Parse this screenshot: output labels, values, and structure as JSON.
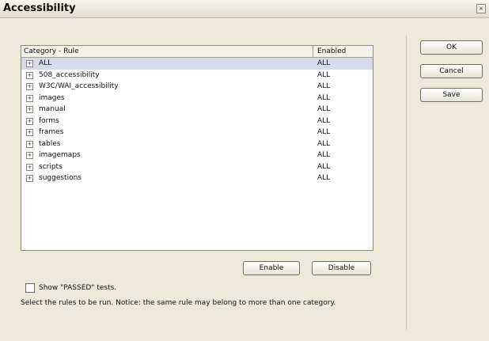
{
  "window": {
    "title": "Accessibility",
    "close_glyph": "×"
  },
  "list": {
    "columns": {
      "category": "Category - Rule",
      "enabled": "Enabled"
    },
    "rows": [
      {
        "label": "ALL",
        "enabled": "ALL",
        "selected": true
      },
      {
        "label": "508_accessibility",
        "enabled": "ALL"
      },
      {
        "label": "W3C/WAI_accessibility",
        "enabled": "ALL"
      },
      {
        "label": "images",
        "enabled": "ALL"
      },
      {
        "label": "manual",
        "enabled": "ALL"
      },
      {
        "label": "forms",
        "enabled": "ALL"
      },
      {
        "label": "frames",
        "enabled": "ALL"
      },
      {
        "label": "tables",
        "enabled": "ALL"
      },
      {
        "label": "imagemaps",
        "enabled": "ALL"
      },
      {
        "label": "scripts",
        "enabled": "ALL"
      },
      {
        "label": "suggestions",
        "enabled": "ALL"
      }
    ],
    "expander_glyph": "+",
    "selected_row_color": "#d6dbe7"
  },
  "buttons": {
    "ok": "OK",
    "cancel": "Cancel",
    "save": "Save",
    "enable": "Enable",
    "disable": "Disable"
  },
  "options": {
    "show_passed_label": "Show \"PASSED\" tests.",
    "show_passed_checked": false
  },
  "hint": "Select the rules to be run. Notice: the same rule may belong to more than one category."
}
